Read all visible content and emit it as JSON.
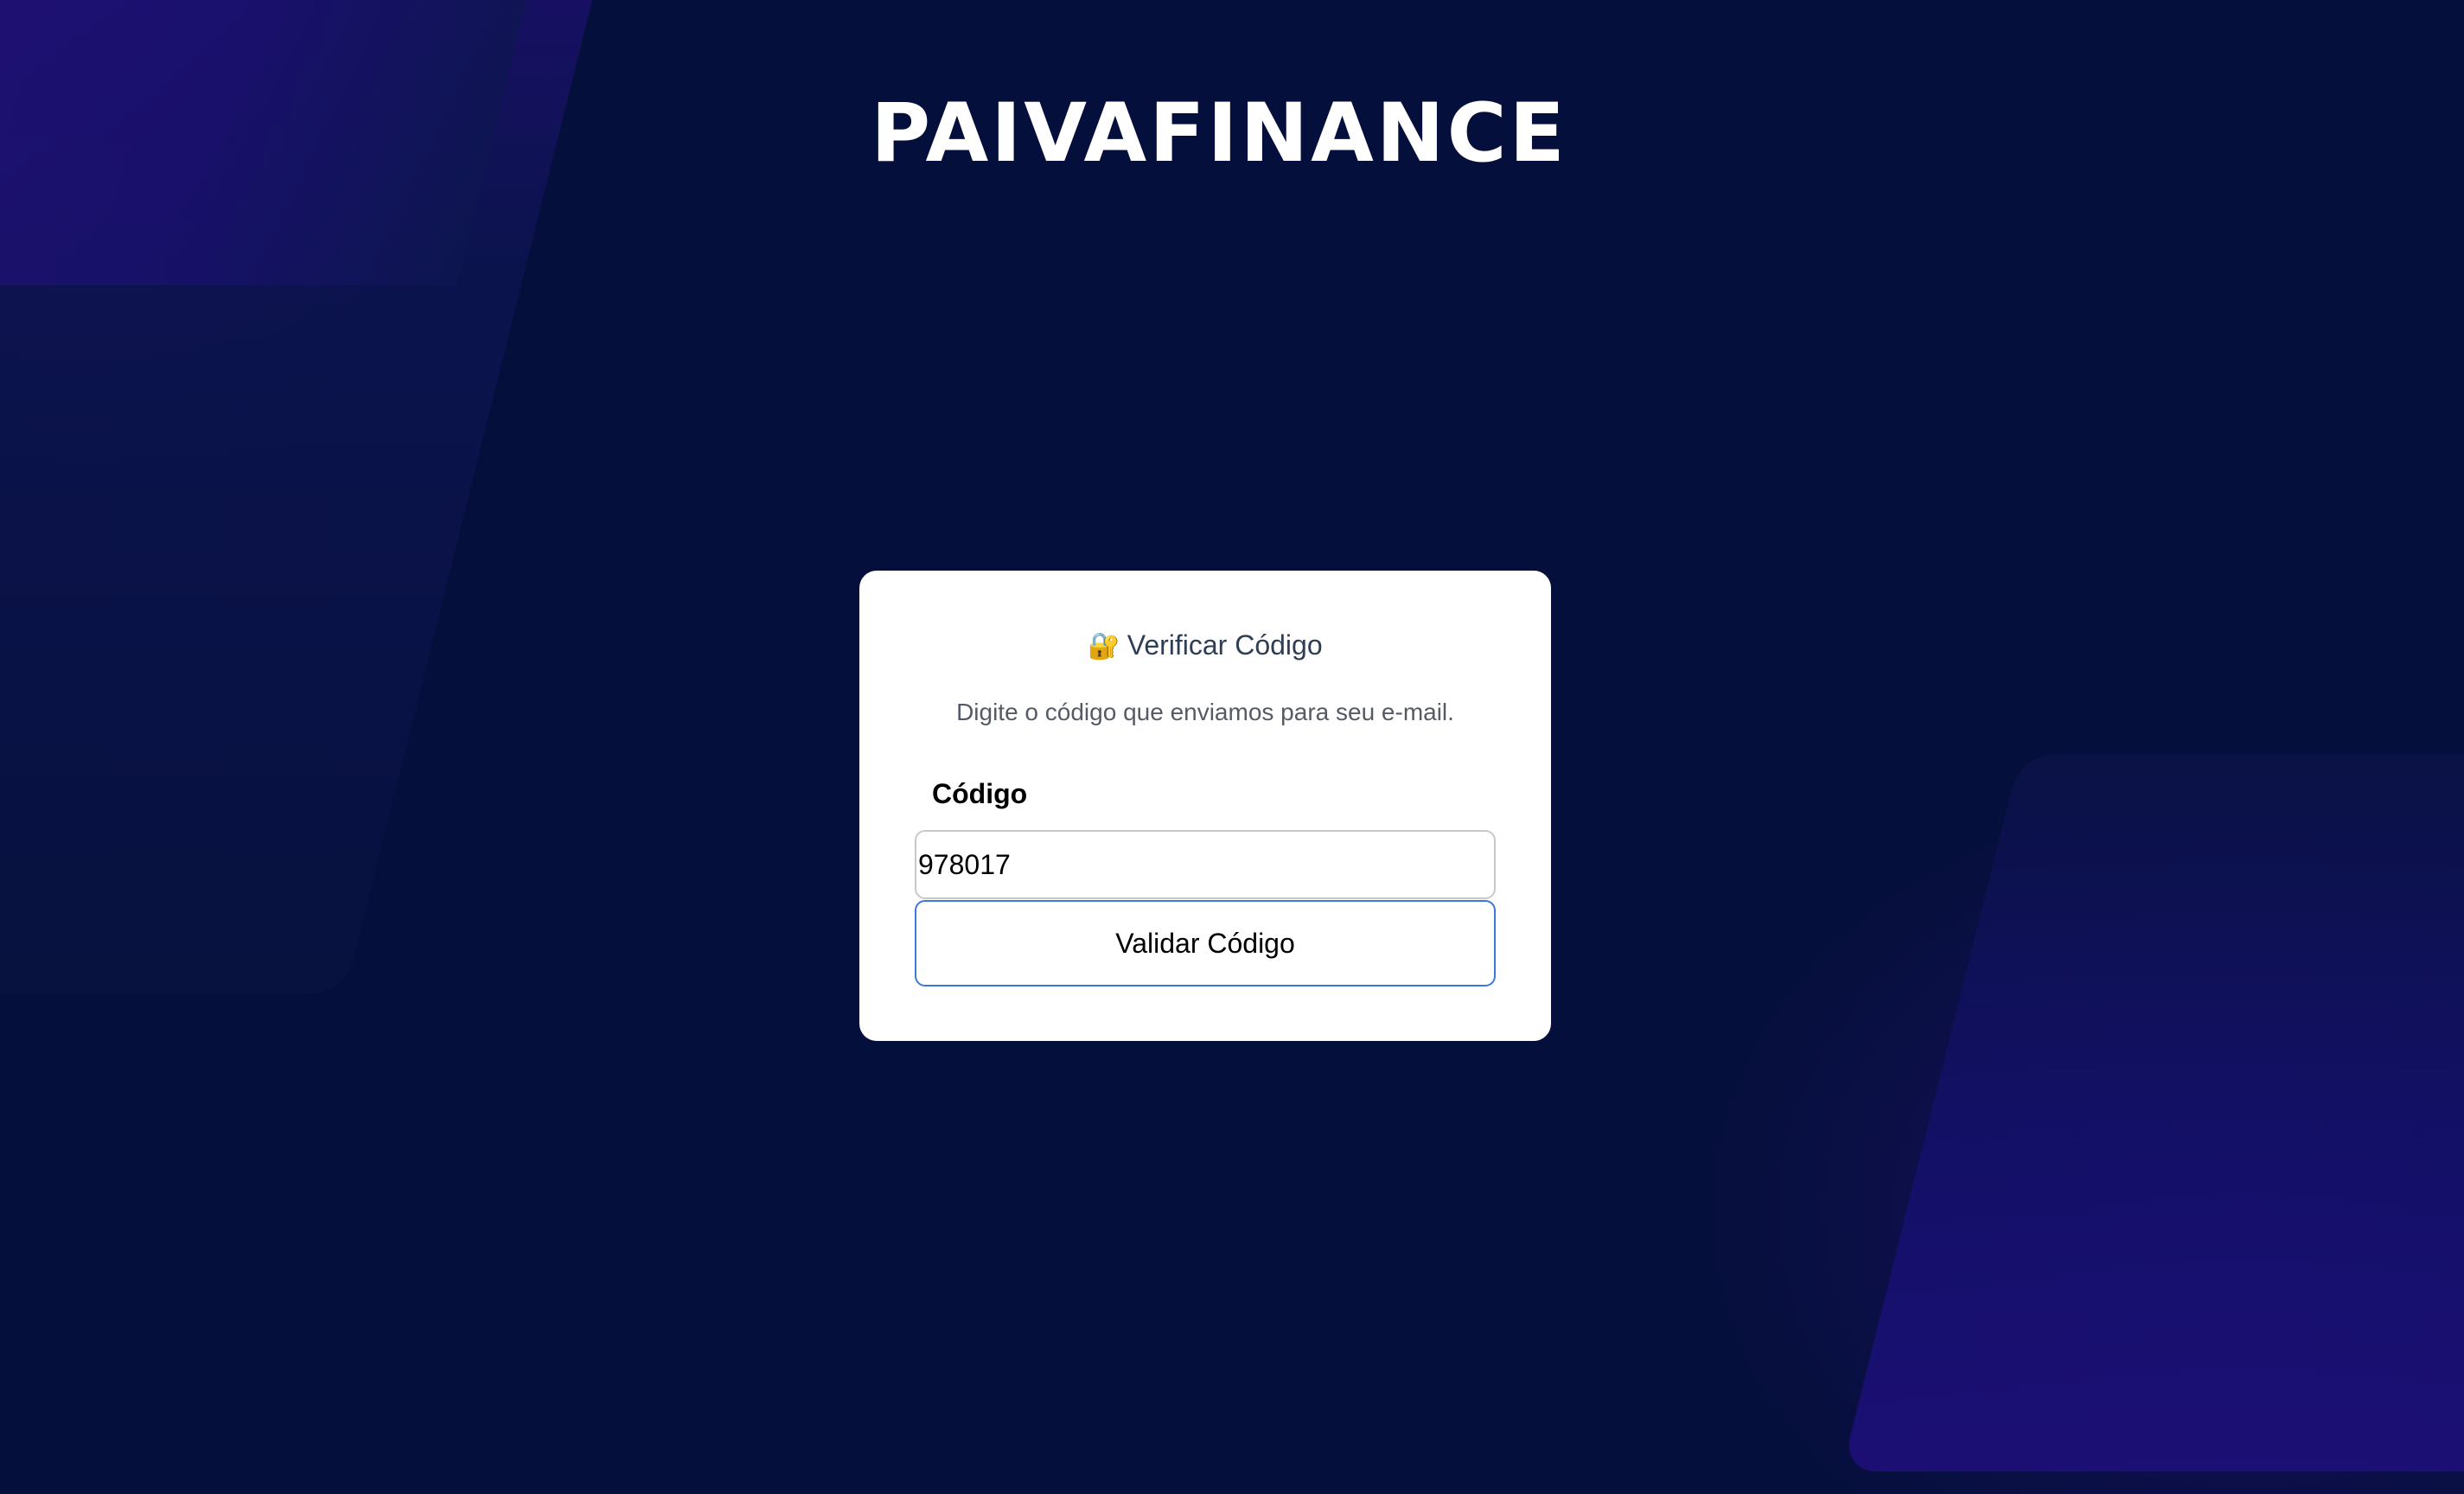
{
  "brand": {
    "logo_text": "PAIVAFINANCE"
  },
  "colors": {
    "background": "#050f3c",
    "accent_purple": "#1d0f6e",
    "card": "#ffffff",
    "button_border": "#3b78d8"
  },
  "verify_card": {
    "lock_icon_glyph": "🔐",
    "title": "Verificar Código",
    "subtitle": "Digite o código que enviamos para seu e-mail.",
    "code_label": "Código",
    "code_value": "978017",
    "submit_label": "Validar Código"
  }
}
